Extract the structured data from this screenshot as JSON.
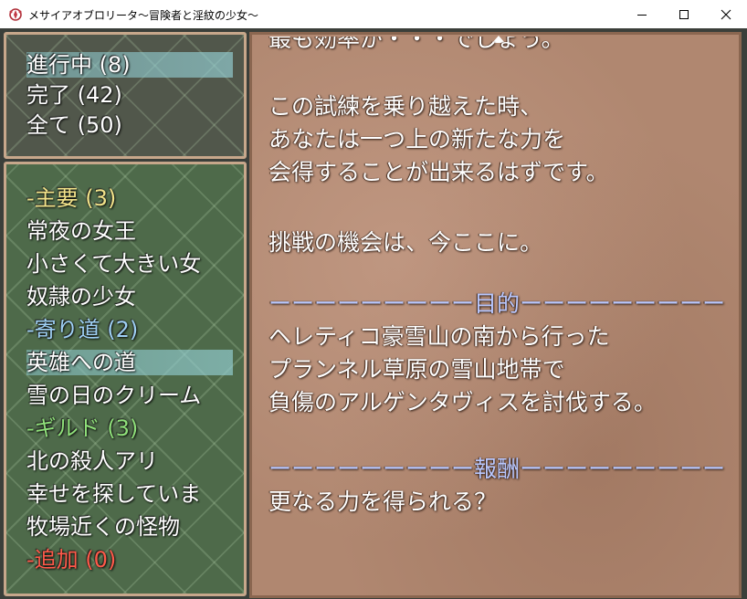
{
  "window": {
    "title": "メサイアオブロリータ～冒険者と淫紋の少女～"
  },
  "filter": {
    "items": [
      {
        "label": "進行中 (8)",
        "selected": true
      },
      {
        "label": "完了 (42)",
        "selected": false
      },
      {
        "label": "全て (50)",
        "selected": false
      }
    ]
  },
  "quest_list": {
    "category_main": {
      "label": "-主要 (3)",
      "color": "#f2e38a"
    },
    "main_items": [
      "常夜の女王",
      "小さくて大きい女",
      "奴隷の少女"
    ],
    "category_side": {
      "label": "-寄り道 (2)",
      "color": "#9fd0f5"
    },
    "side_items": [
      "英雄への道",
      "雪の日のクリーム"
    ],
    "selected_item": "英雄への道",
    "category_guild": {
      "label": "-ギルド (3)",
      "color": "#8fe07a"
    },
    "guild_items": [
      "北の殺人アリ",
      "幸せを探していま",
      "牧場近くの怪物"
    ],
    "category_extra": {
      "label": "-追加 (0)",
      "color": "#ff5a4a"
    }
  },
  "detail": {
    "top_partial": "最も効率が・・・でしょう。",
    "lines1": [
      "この試練を乗り越えた時、",
      "あなたは一つ上の新たな力を",
      "会得することが出来るはずです。"
    ],
    "line2": "挑戦の機会は、今ここに。",
    "objective_header": "ーーーーーーーーー目的ーーーーーーーーー",
    "objective_lines": [
      "ヘレティコ豪雪山の南から行った",
      "プランネル草原の雪山地帯で",
      "負傷のアルゲンタヴィスを討伐する。"
    ],
    "reward_header": "ーーーーーーーーー報酬ーーーーーーーーー",
    "reward_line": "更なる力を得られる？"
  }
}
